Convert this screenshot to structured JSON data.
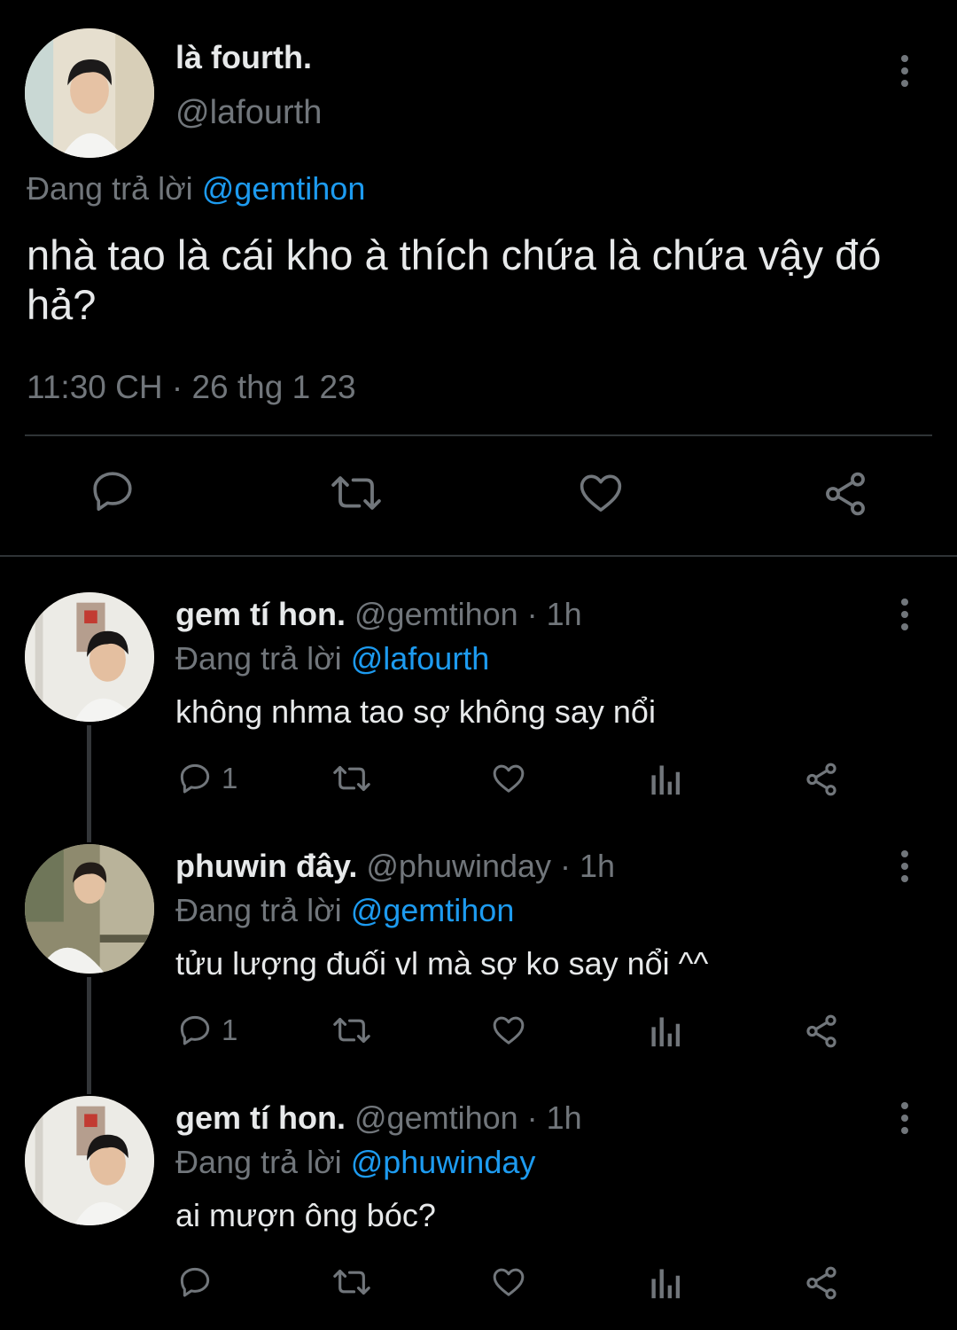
{
  "main_tweet": {
    "display_name": "là fourth.",
    "handle": "@lafourth",
    "replying_prefix": "Đang trả lời",
    "replying_to": "@gemtihon",
    "text": "nhà tao là cái kho à thích chứa là chứa vậy đó hả?",
    "timestamp": "11:30 CH · 26 thg 1 23",
    "actions": [
      "reply-icon",
      "retweet-icon",
      "like-icon",
      "share-icon"
    ]
  },
  "replies": [
    {
      "display_name": "gem tí hon.",
      "handle": "@gemtihon",
      "time": "· 1h",
      "replying_prefix": "Đang trả lời",
      "replying_to": "@lafourth",
      "text": "không nhma tao sợ không say nổi",
      "reply_count": "1"
    },
    {
      "display_name": "phuwin đây.",
      "handle": "@phuwinday",
      "time": "· 1h",
      "replying_prefix": "Đang trả lời",
      "replying_to": "@gemtihon",
      "text": "tửu lượng đuối vl mà sợ ko say nổi ^^",
      "reply_count": "1"
    },
    {
      "display_name": "gem tí hon.",
      "handle": "@gemtihon",
      "time": "· 1h",
      "replying_prefix": "Đang trả lời",
      "replying_to": "@phuwinday",
      "text": "ai mượn ông bóc?",
      "reply_count": ""
    }
  ],
  "colors": {
    "background": "#000000",
    "text": "#e7e9ea",
    "muted": "#71767b",
    "accent": "#1d9bf0",
    "divider": "#2f3336"
  }
}
